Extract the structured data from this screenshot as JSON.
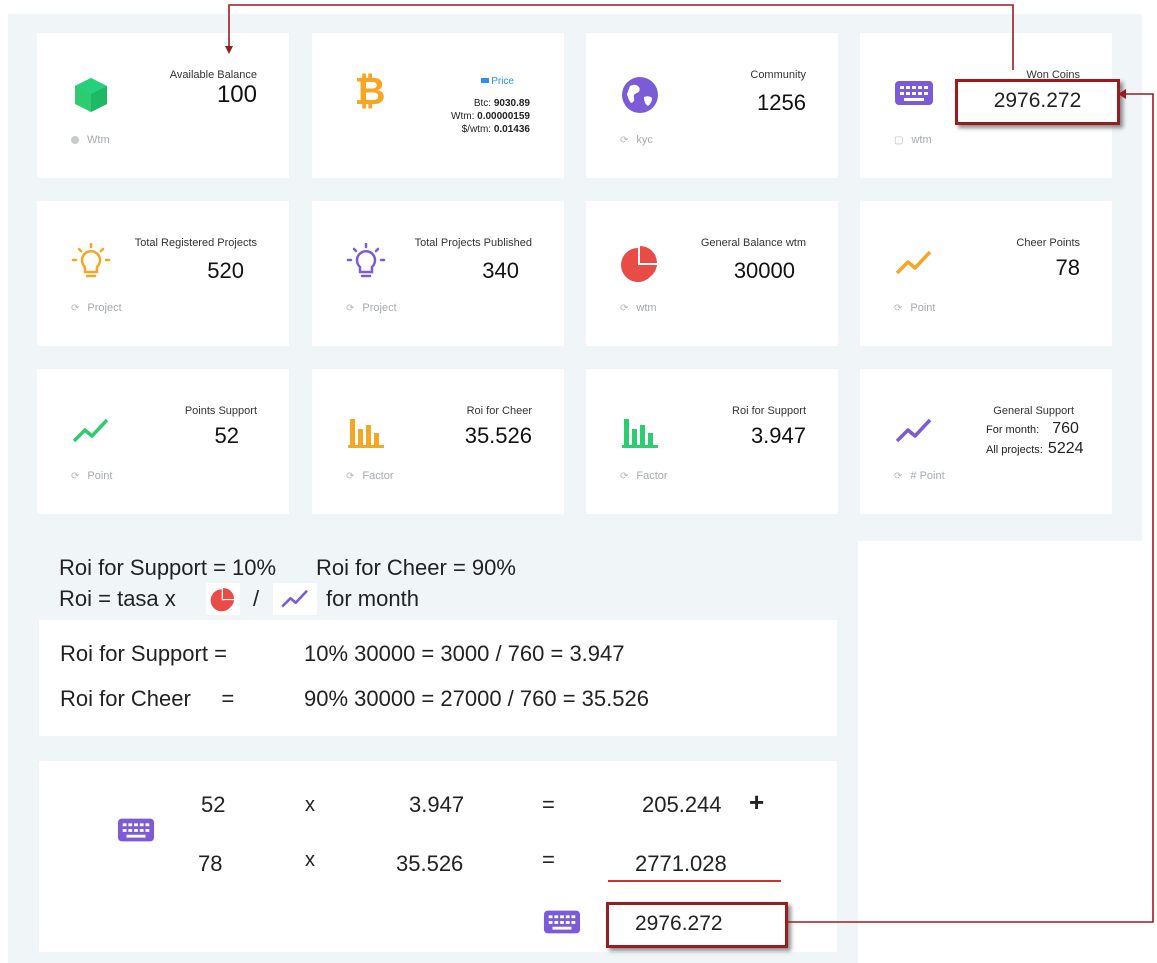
{
  "cards": {
    "available_balance": {
      "label": "Available Balance",
      "value": "100",
      "footer": "Wtm"
    },
    "price": {
      "label": "Price",
      "btc_label": "Btc:",
      "btc": "9030.89",
      "wtm_label": "Wtm:",
      "wtm": "0.00000159",
      "swtm_label": "$/wtm:",
      "swtm": "0.01436"
    },
    "community": {
      "label": "Community",
      "value": "1256",
      "footer": "kyc"
    },
    "won_coins": {
      "label": "Won Coins",
      "value": "2976.272",
      "footer": "wtm"
    },
    "total_registered_projects": {
      "label": "Total Registered Projects",
      "value": "520",
      "footer": "Project"
    },
    "total_projects_published": {
      "label": "Total Projects Published",
      "value": "340",
      "footer": "Project"
    },
    "general_balance": {
      "label": "General Balance wtm",
      "value": "30000",
      "footer": "wtm"
    },
    "cheer_points": {
      "label": "Cheer Points",
      "value": "78",
      "footer": "Point"
    },
    "points_support": {
      "label": "Points Support",
      "value": "52",
      "footer": "Point"
    },
    "roi_cheer": {
      "label": "Roi for Cheer",
      "value": "35.526",
      "footer": "Factor"
    },
    "roi_support": {
      "label": "Roi for Support",
      "value": "3.947",
      "footer": "Factor"
    },
    "general_support": {
      "label": "General Support",
      "month_label": "For month:",
      "month_value": "760",
      "all_label": "All projects:",
      "all_value": "5224",
      "footer": "# Point"
    }
  },
  "notes": {
    "line1_a": "Roi for Support = 10%",
    "line1_b": "Roi for Cheer = 90%",
    "line2_a": "Roi  = tasa  x",
    "line2_slash": "/",
    "line2_b": "for month"
  },
  "formulas": {
    "support_label": "Roi for Support  =",
    "support_expr": "10% 30000 = 3000 /  760   =  3.947",
    "cheer_label": "Roi for Cheer     =",
    "cheer_expr": "90% 30000 = 27000 /  760  =  35.526"
  },
  "calc": {
    "row1": {
      "a": "52",
      "op": "x",
      "b": "3.947",
      "eq": "=",
      "result": "205.244",
      "plus": "+"
    },
    "row2": {
      "a": "78",
      "op": "x",
      "b": "35.526",
      "eq": "=",
      "result": "2771.028"
    },
    "total": "2976.272"
  },
  "colors": {
    "accent_red": "#9b1c20",
    "green": "#2ecc71",
    "orange": "#f5a623",
    "purple": "#7b5cd6",
    "red_pie": "#e94b47"
  },
  "icons": [
    "cube-icon",
    "bitcoin-icon",
    "globe-icon",
    "keyboard-icon",
    "lightbulb-icon",
    "pie-chart-icon",
    "trend-line-icon",
    "bar-chart-icon"
  ]
}
